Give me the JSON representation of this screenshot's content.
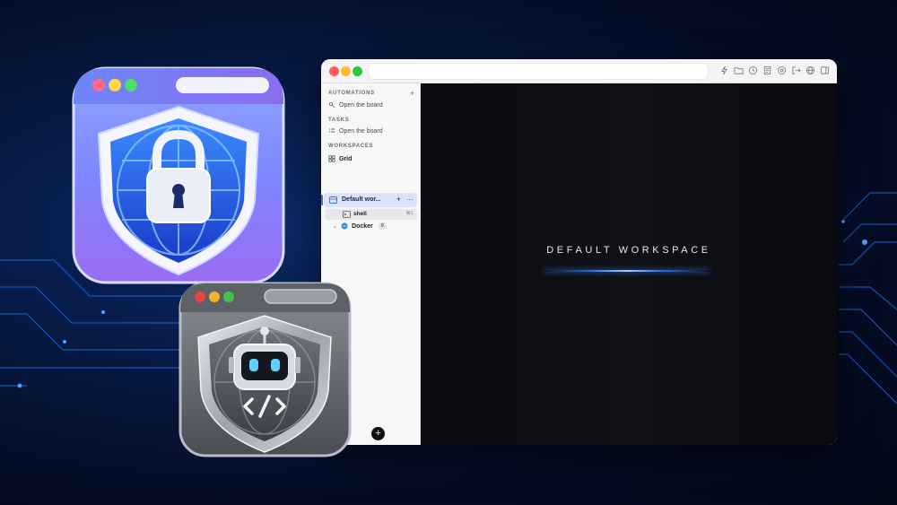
{
  "colors": {
    "background": "#061538",
    "accent": "#2f6ee8",
    "selection": "#d9e4fb",
    "terminal_bg": "#0d0e12",
    "traffic_red": "#ff5f57",
    "traffic_yellow": "#febc2e",
    "traffic_green": "#28c840"
  },
  "toolbar": {
    "icons": [
      "bolt-icon",
      "folder-icon",
      "clock-icon",
      "document-icon",
      "settings-icon",
      "logout-icon",
      "globe-icon",
      "panel-icon"
    ]
  },
  "sidebar": {
    "automations": {
      "header": "AUTOMATIONS",
      "add": "+",
      "item": "Open the board"
    },
    "tasks": {
      "header": "TASKS",
      "item": "Open the board"
    },
    "workspaces": {
      "header": "WORKSPACES",
      "grid": "Grid",
      "default": {
        "name": "Default wor...",
        "add": "+",
        "more": "···"
      },
      "shell": {
        "name": "shell",
        "shortcut": "⌘1"
      },
      "docker": {
        "name": "Docker",
        "count": "0"
      }
    },
    "fab": "+"
  },
  "content": {
    "title": "DEFAULT WORKSPACE"
  },
  "decor_icons": [
    "security-app-icon",
    "agent-app-icon"
  ]
}
